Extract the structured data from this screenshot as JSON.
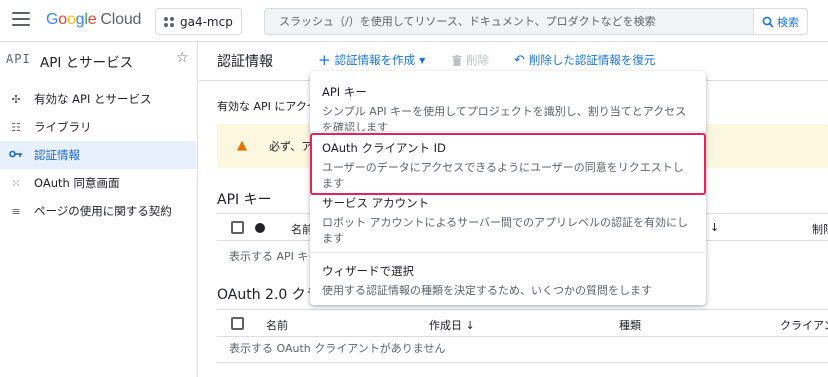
{
  "header": {
    "logo_parts": [
      "G",
      "o",
      "o",
      "g",
      "l",
      "e"
    ],
    "logo_cloud": "Cloud",
    "project": "ga4-mcp",
    "search_placeholder": "スラッシュ（/）を使用してリソース、ドキュメント、プロダクトなどを検索",
    "search_button": "検索"
  },
  "sidebar": {
    "api_label": "API",
    "title": "API とサービス",
    "items": [
      {
        "label": "有効な API とサービス",
        "icon": "enabled-apis-icon"
      },
      {
        "label": "ライブラリ",
        "icon": "library-icon"
      },
      {
        "label": "認証情報",
        "icon": "key-icon",
        "active": true
      },
      {
        "label": "OAuth 同意画面",
        "icon": "consent-icon"
      },
      {
        "label": "ページの使用に関する契約",
        "icon": "settings-list-icon"
      }
    ]
  },
  "main": {
    "title": "認証情報",
    "create_label": "認証情報を作成",
    "delete_label": "削除",
    "restore_label": "削除した認証情報を復元",
    "intro_text": "有効な API にアクセ",
    "warning_text": "必ず、ア",
    "api_keys": {
      "title": "API キー",
      "columns": [
        "名前",
        "制限"
      ],
      "empty": "表示する API キー"
    },
    "oauth": {
      "title": "OAuth 2.0 クラ",
      "columns": [
        "名前",
        "作成日",
        "種類",
        "クライアン"
      ],
      "empty": "表示する OAuth クライアントがありません"
    }
  },
  "menu": {
    "items": [
      {
        "title": "API キー",
        "desc": "シンプル API キーを使用してプロジェクトを識別し、割り当てとアクセスを確認します"
      },
      {
        "title": "OAuth クライアント ID",
        "desc": "ユーザーのデータにアクセスできるようにユーザーの同意をリクエストします"
      },
      {
        "title": "サービス アカウント",
        "desc": "ロボット アカウントによるサーバー間でのアプリレベルの認証を有効にします"
      },
      {
        "title": "ウィザードで選択",
        "desc": "使用する認証情報の種類を決定するため、いくつかの質問をします"
      }
    ]
  },
  "colors": {
    "accent": "#1a73e8",
    "highlight": "#e0245e",
    "warning_bg": "#fef7e0"
  }
}
